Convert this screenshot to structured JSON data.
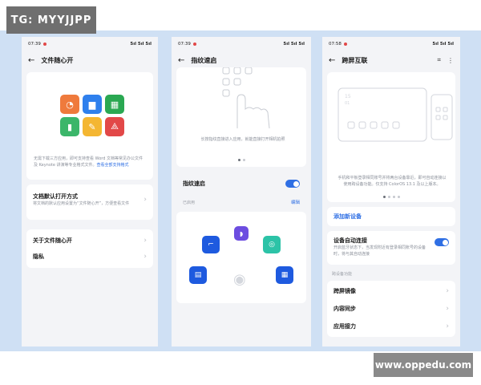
{
  "watermark_top": "TG: MYYJJPP",
  "watermark_bottom": "www.oppedu.com",
  "status": {
    "p1_time": "07:39",
    "p2_time": "07:39",
    "p3_time": "07:58",
    "signal": "5ıl 5ıl 5ıl"
  },
  "screen1": {
    "title": "文件随心开",
    "desc": "无需下载三方应用，即可支持查看 Word 文档等常见办公文件及 Keynote 讲演等专业格式文件。",
    "link": "查看全部支持格式",
    "default_open_title": "文档默认打开方式",
    "default_open_desc": "将文档的默认应用设置为“文件随心开”，方便查看文件",
    "about": "关于文件随心开",
    "privacy": "隐私"
  },
  "screen2": {
    "title": "指纹速启",
    "desc": "长按指纹直接进入应用，就能直接打开相机拍照",
    "toggle_label": "指纹速启",
    "section": "已启用",
    "edit": "编辑"
  },
  "screen3": {
    "title": "跨屏互联",
    "desc": "手机和平板登录相同账号并将两台设备靠近，即可自动连接以使用跨设备功能。仅支持 ColorOS 13.1 及以上版本。",
    "add_device": "添加新设备",
    "auto_connect_title": "设备自动连接",
    "auto_connect_desc": "开启蓝牙状态下，当发现附近有登录相同账号的设备时，将与其自动连接",
    "section": "跨设备功能",
    "item1": "跨屏镜像",
    "item2": "内容同步",
    "item3": "应用接力"
  },
  "colors": {
    "accent": "#2f6fe4",
    "background": "#cfe0f4"
  }
}
